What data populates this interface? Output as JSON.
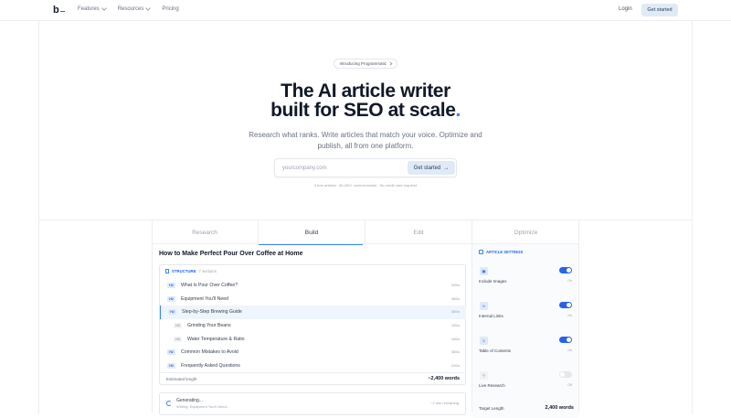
{
  "nav": {
    "logo": "b",
    "links": [
      {
        "label": "Features"
      },
      {
        "label": "Resources"
      },
      {
        "label": "Pricing"
      }
    ],
    "login": "Login",
    "cta": "Get started"
  },
  "hero": {
    "pill": "Introducing Programmatic",
    "title_line1": "The AI article writer",
    "title_line2": "built for SEO at scale",
    "title_dot": ".",
    "subtitle_line1": "Research what ranks. Write articles that match your voice. Optimize and",
    "subtitle_line2": "publish, all from one platform.",
    "input_placeholder": "yourcompany.com",
    "input_button": "Get started",
    "fine_print": "3 free articles · 80,000+ content teams · No credit card required"
  },
  "tabs": [
    {
      "label": "Research",
      "active": false
    },
    {
      "label": "Build",
      "active": true
    },
    {
      "label": "Edit",
      "active": false
    },
    {
      "label": "Optimize",
      "active": false
    }
  ],
  "article": {
    "title": "How to Make Perfect Pour Over Coffee at Home",
    "structure_label": "STRUCTURE",
    "structure_count": "7 sections",
    "outline": [
      {
        "level": "H2",
        "text": "What Is Pour Over Coffee?",
        "words": "320w",
        "highlight": false
      },
      {
        "level": "H2",
        "text": "Equipment You'll Need",
        "words": "380w",
        "highlight": false
      },
      {
        "level": "H2",
        "text": "Step-by-Step Brewing Guide",
        "words": "480w",
        "highlight": true
      },
      {
        "level": "H3",
        "text": "Grinding Your Beans",
        "words": "180w",
        "highlight": false
      },
      {
        "level": "H3",
        "text": "Water Temperature & Ratio",
        "words": "160w",
        "highlight": false
      },
      {
        "level": "H2",
        "text": "Common Mistakes to Avoid",
        "words": "360w",
        "highlight": false
      },
      {
        "level": "H2",
        "text": "Frequently Asked Questions",
        "words": "240w",
        "highlight": false
      }
    ],
    "estimated_label": "Estimated length",
    "estimated_value": "~2,400 words",
    "generating": "Generating...",
    "generating_detail": "Writing: Equipment You'll Need...",
    "remaining": "~2 min remaining"
  },
  "settings": {
    "header": "ARTICLE SETTINGS",
    "items": [
      {
        "label": "Include Images",
        "state": "On",
        "on": true,
        "icon": "image-icon",
        "glyph": "▣"
      },
      {
        "label": "Internal Links",
        "state": "On",
        "on": true,
        "icon": "link-icon",
        "glyph": "∞"
      },
      {
        "label": "Table of Contents",
        "state": "On",
        "on": true,
        "icon": "list-icon",
        "glyph": "≡"
      },
      {
        "label": "Live Research",
        "state": "Off",
        "on": false,
        "icon": "flask-icon",
        "glyph": "⚲"
      }
    ],
    "target_label": "Target Length",
    "target_value": "2,400 words"
  },
  "colors": {
    "accent": "#2563eb",
    "accent_light": "#e0eaf5",
    "title_dot": "#3b82f6"
  }
}
